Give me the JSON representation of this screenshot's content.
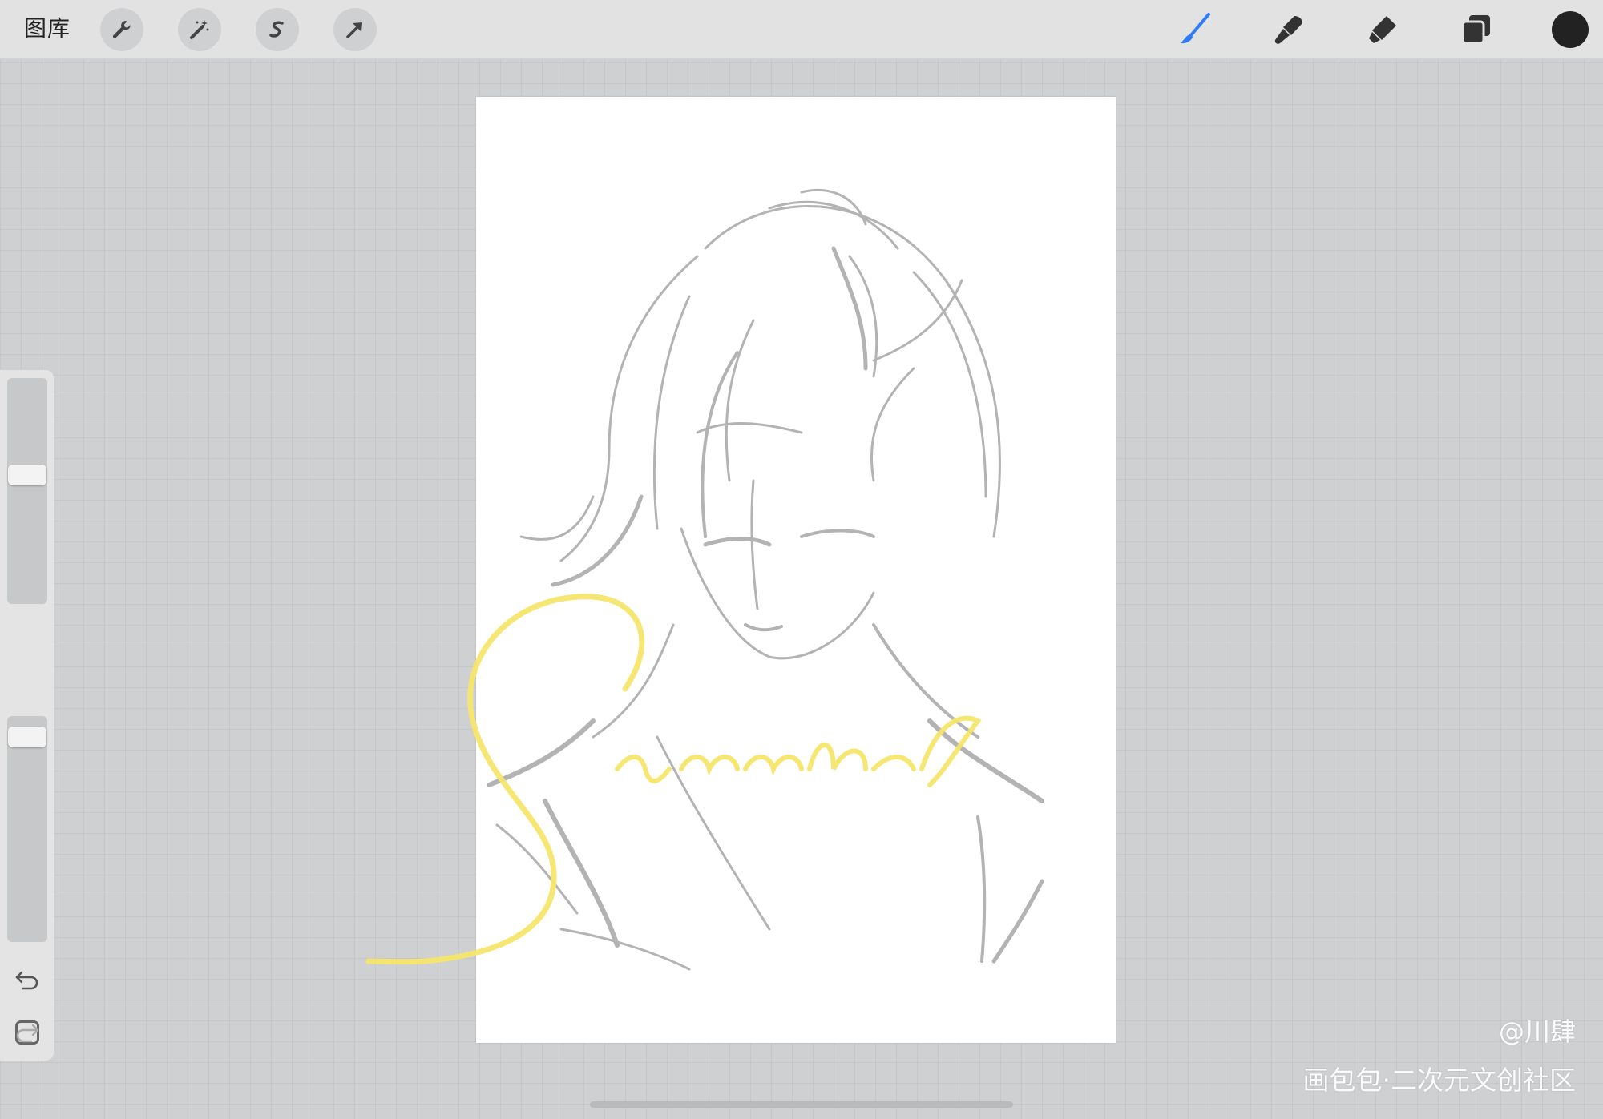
{
  "toolbar": {
    "gallery_label": "图库",
    "left_tools": [
      {
        "name": "actions",
        "icon": "wrench-icon"
      },
      {
        "name": "adjustments",
        "icon": "magic-wand-icon"
      },
      {
        "name": "selection",
        "icon": "selection-s-icon"
      },
      {
        "name": "transform",
        "icon": "arrow-icon"
      }
    ],
    "right_tools": [
      {
        "name": "brush",
        "icon": "brush-icon",
        "active": true
      },
      {
        "name": "smudge",
        "icon": "smudge-icon"
      },
      {
        "name": "eraser",
        "icon": "eraser-icon"
      },
      {
        "name": "layers",
        "icon": "layers-icon"
      },
      {
        "name": "color",
        "icon": "color-swatch",
        "value": "#222222"
      }
    ],
    "accent_color": "#2f7cf6"
  },
  "sidebar": {
    "brush_size": 0.58,
    "opacity": 0.95,
    "icons": [
      "modify-square-icon",
      "undo-icon",
      "redo-icon"
    ]
  },
  "canvas": {
    "lettering": "Summer",
    "lettering_color": "#f6e56b"
  },
  "watermark": {
    "handle": "@川肆",
    "site": "画包包·二次元文创社区"
  }
}
